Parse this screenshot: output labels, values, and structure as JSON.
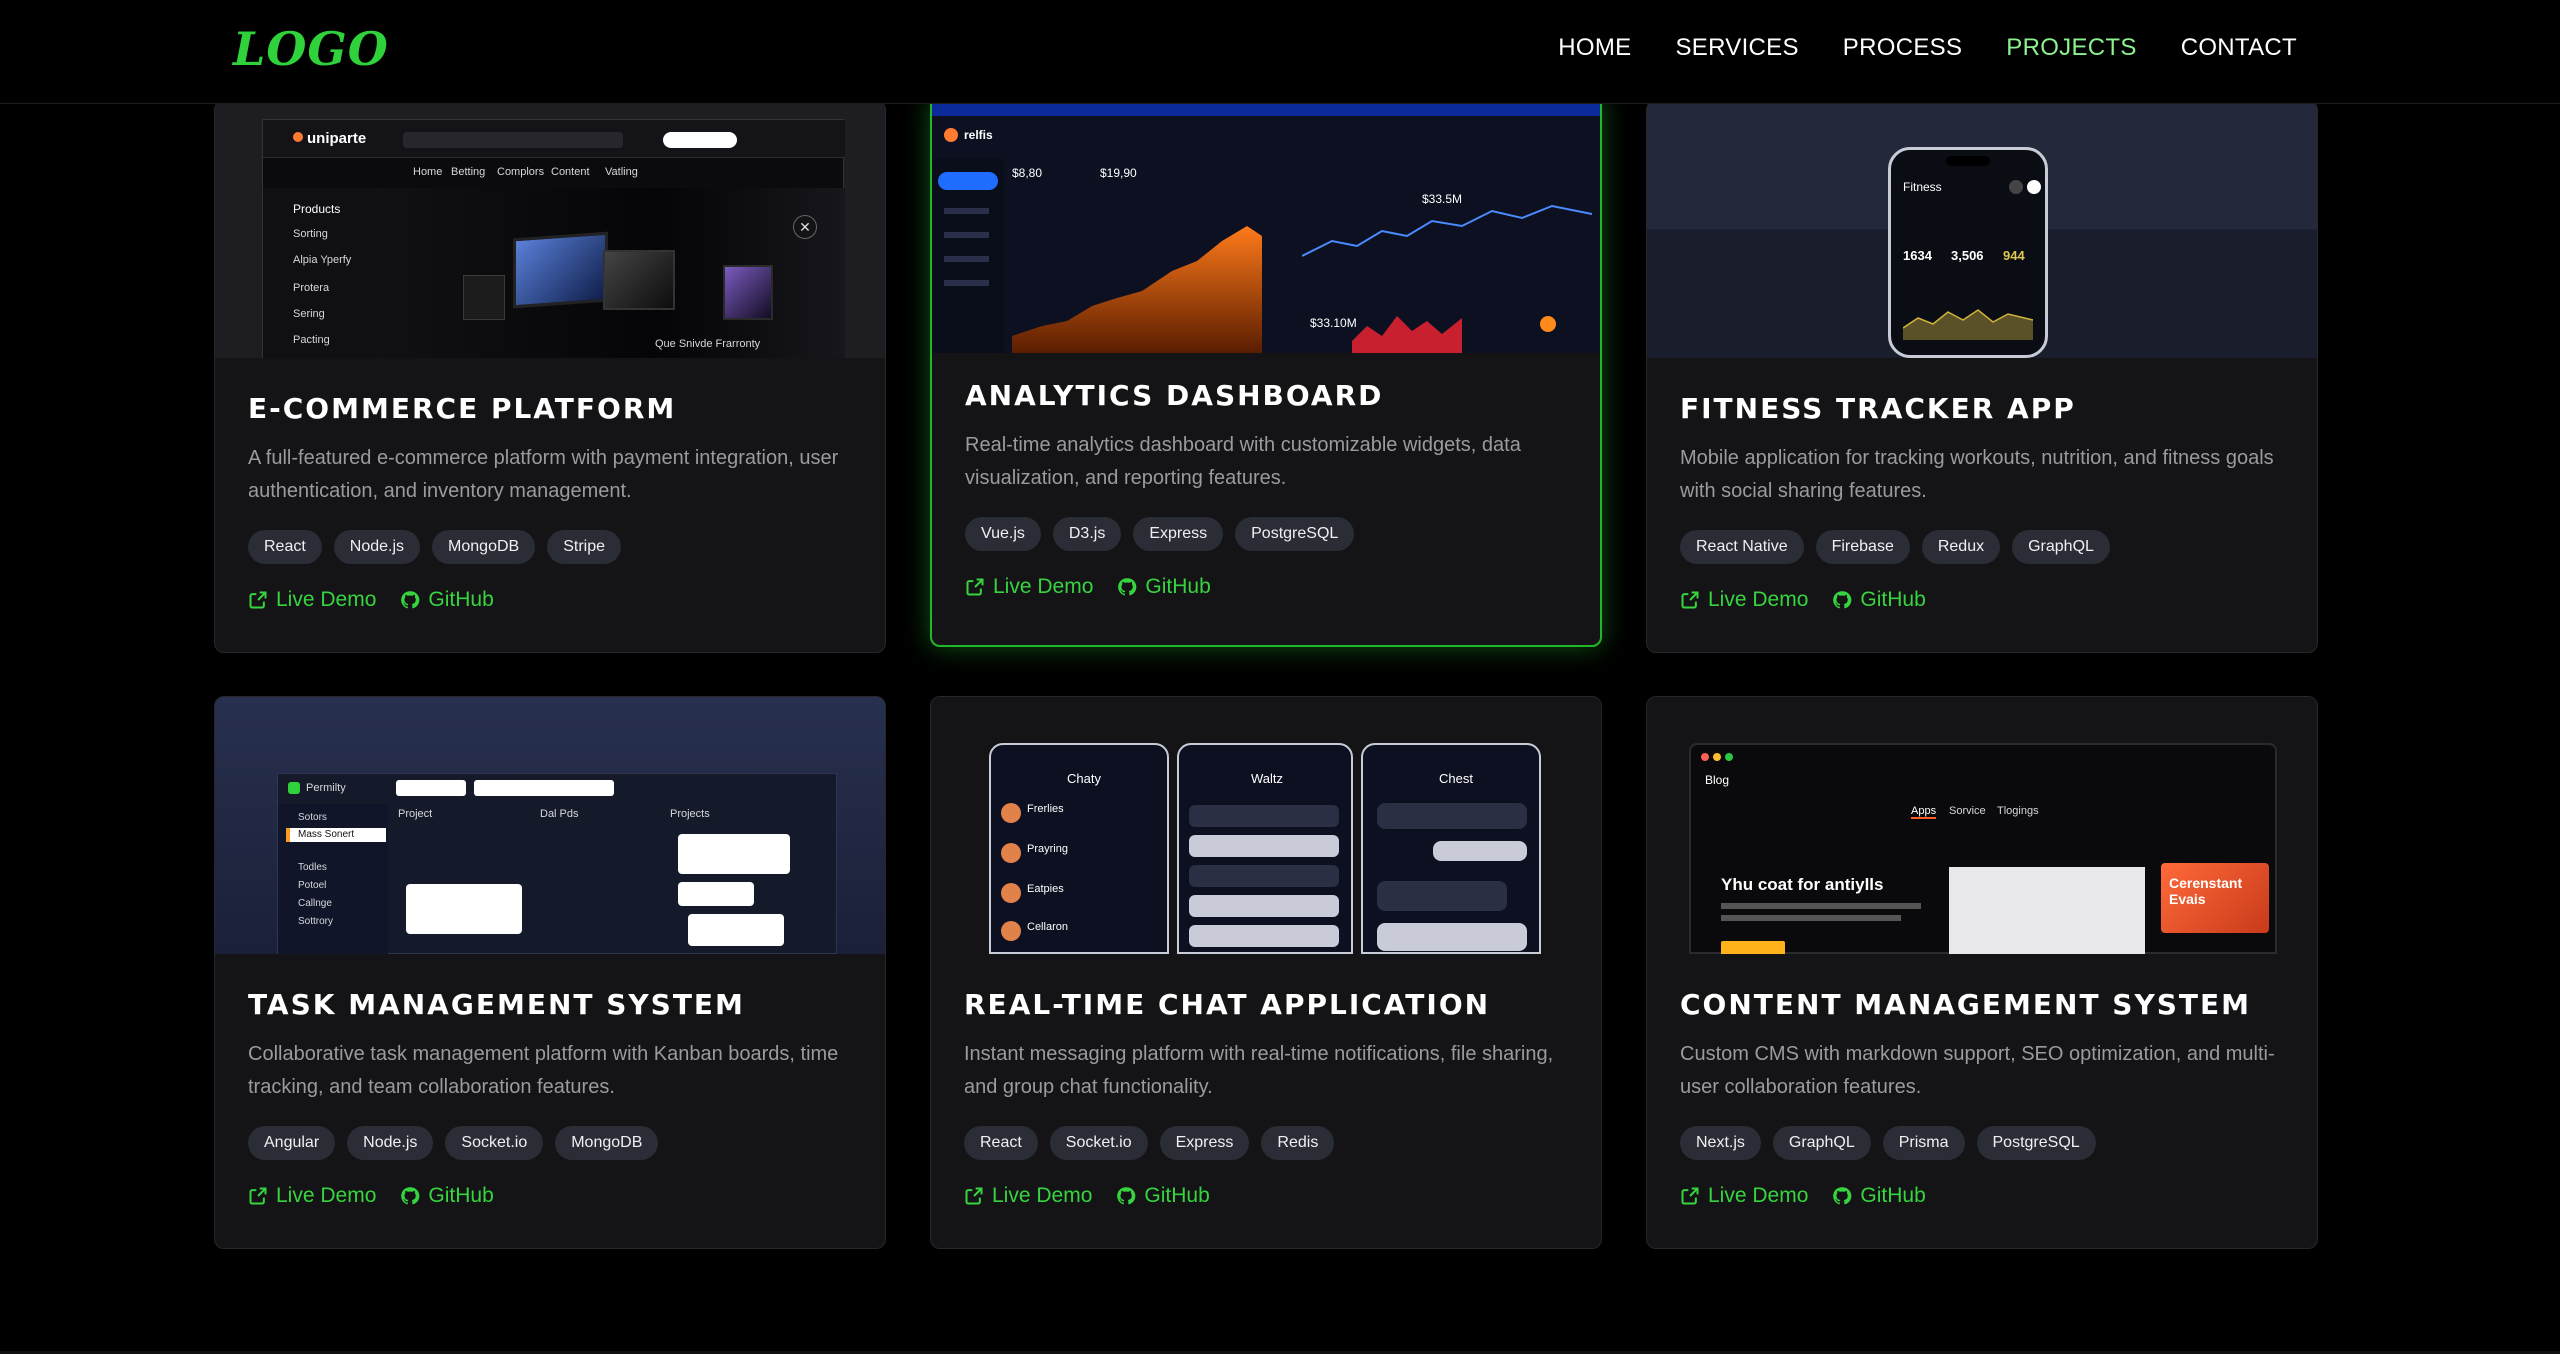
{
  "header": {
    "logo": "LOGO",
    "nav": [
      "HOME",
      "SERVICES",
      "PROCESS",
      "PROJECTS",
      "CONTACT"
    ],
    "active": "PROJECTS"
  },
  "colors": {
    "accent": "#36d43f",
    "nav_active": "#8cf28f",
    "card_bg": "#141416",
    "tag_bg": "#2a2d36"
  },
  "projects": [
    {
      "title": "E-COMMERCE PLATFORM",
      "description": "A full-featured e-commerce platform with payment integration, user authentication, and inventory management.",
      "tags": [
        "React",
        "Node.js",
        "MongoDB",
        "Stripe"
      ],
      "links": {
        "demo": "Live Demo",
        "github": "GitHub"
      },
      "thumb": {
        "brand": "uniparte",
        "menu": [
          "Home",
          "Betting",
          "Complors",
          "Content",
          "Vatling"
        ],
        "sidebar": [
          "Products",
          "Sorting",
          "Alpia Yperfy",
          "Protera",
          "Sering",
          "Pacting"
        ],
        "caption": "Que Snivde Frarronty"
      }
    },
    {
      "title": "ANALYTICS DASHBOARD",
      "description": "Real-time analytics dashboard with customizable widgets, data visualization, and reporting features.",
      "tags": [
        "Vue.js",
        "D3.js",
        "Express",
        "PostgreSQL"
      ],
      "links": {
        "demo": "Live Demo",
        "github": "GitHub"
      },
      "thumb": {
        "brand": "relfis",
        "metric_a": "$33.5M",
        "metric_b": "$33.10M",
        "metric_c": "$8,80",
        "metric_d": "$19,90"
      }
    },
    {
      "title": "FITNESS TRACKER APP",
      "description": "Mobile application for tracking workouts, nutrition, and fitness goals with social sharing features.",
      "tags": [
        "React Native",
        "Firebase",
        "Redux",
        "GraphQL"
      ],
      "links": {
        "demo": "Live Demo",
        "github": "GitHub"
      },
      "thumb": {
        "app": "Fitness",
        "stats": [
          "1634",
          "3,506",
          "944"
        ]
      }
    },
    {
      "title": "TASK MANAGEMENT SYSTEM",
      "description": "Collaborative task management platform with Kanban boards, time tracking, and team collaboration features.",
      "tags": [
        "Angular",
        "Node.js",
        "Socket.io",
        "MongoDB"
      ],
      "links": {
        "demo": "Live Demo",
        "github": "GitHub"
      },
      "thumb": {
        "brand": "Permilty",
        "cols": [
          "Project",
          "Dal Pds",
          "Projects"
        ],
        "sidebar": [
          "Sotors",
          "Mass Sonert",
          "Todles",
          "Potoel",
          "Callnge",
          "Sottrory"
        ]
      }
    },
    {
      "title": "REAL-TIME CHAT APPLICATION",
      "description": "Instant messaging platform with real-time notifications, file sharing, and group chat functionality.",
      "tags": [
        "React",
        "Socket.io",
        "Express",
        "Redis"
      ],
      "links": {
        "demo": "Live Demo",
        "github": "GitHub"
      },
      "thumb": {
        "screens": [
          "Chaty",
          "Waltz",
          "Chest"
        ],
        "contacts": [
          "Frerlies",
          "Prayring",
          "Eatpies",
          "Cellaron"
        ]
      }
    },
    {
      "title": "CONTENT MANAGEMENT SYSTEM",
      "description": "Custom CMS with markdown support, SEO optimization, and multi-user collaboration features.",
      "tags": [
        "Next.js",
        "GraphQL",
        "Prisma",
        "PostgreSQL"
      ],
      "links": {
        "demo": "Live Demo",
        "github": "GitHub"
      },
      "thumb": {
        "back": "Blog",
        "tabs": [
          "Apps",
          "Sorvice",
          "Tlogings"
        ],
        "headline": "Yhu coat for antiylls",
        "promo": "Cerenstant Evais"
      }
    }
  ]
}
